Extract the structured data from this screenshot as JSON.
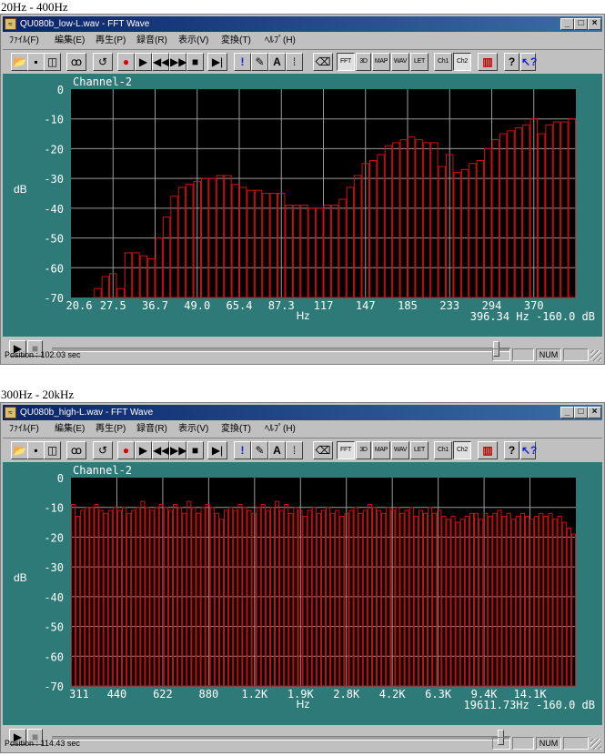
{
  "windows": [
    {
      "caption": "20Hz - 400Hz",
      "title": "QU080b_low-L.wav - FFT Wave",
      "channel_label": "Channel-2",
      "ylabel": "dB",
      "xlabel": "Hz",
      "readout": "396.34  Hz -160.0 dB",
      "status_position": "Position : 102.03 sec",
      "slider_fraction": 0.97
    },
    {
      "caption": "300Hz - 20kHz",
      "title": "QU080b_high-L.wav - FFT Wave",
      "channel_label": "Channel-2",
      "ylabel": "dB",
      "xlabel": "Hz",
      "readout": "19611.73Hz -160.0 dB",
      "status_position": "Position : 114.43 sec",
      "slider_fraction": 0.98
    }
  ],
  "menu": [
    "ﾌｧｲﾙ(F)",
    "編集(E)",
    "再生(P)",
    "録音(R)",
    "表示(V)",
    "変換(T)",
    "ﾍﾙﾌﾟ(H)"
  ],
  "toolbar": {
    "fft": "FFT",
    "3d": "3D",
    "map": "MAP",
    "wav": "WAV",
    "let": "LET",
    "ch1": "Ch1",
    "ch2": "Ch2",
    "text_a": "A"
  },
  "window_buttons": {
    "minimize": "_",
    "maximize": "□",
    "close": "×"
  },
  "status_num": "NUM",
  "colors": {
    "plot_bg": "#2d7a78",
    "plot_area": "#000000",
    "bar_stroke": "#d01010",
    "grid": "#9a9a9a",
    "title_bar": "#0a246a"
  },
  "chart_data": [
    {
      "type": "bar",
      "ylim": [
        -70,
        0
      ],
      "yticks": [
        "0",
        "-10",
        "-20",
        "-30",
        "-40",
        "-50",
        "-60",
        "-70"
      ],
      "xticks": [
        "20.6",
        "27.5",
        "36.7",
        "49.0",
        "65.4",
        "87.3",
        "117",
        "147",
        "185",
        "233",
        "294",
        "370"
      ],
      "values": [
        -71,
        -71,
        -70,
        -67,
        -63,
        -62,
        -67,
        -55,
        -55,
        -56,
        -57,
        -50,
        -43,
        -36,
        -33,
        -32,
        -31,
        -30,
        -30,
        -29,
        -29,
        -32,
        -33,
        -34,
        -34,
        -35,
        -35,
        -35,
        -39,
        -39,
        -39,
        -40,
        -40,
        -39,
        -39,
        -37,
        -33,
        -29,
        -25,
        -24,
        -22,
        -19,
        -18,
        -17,
        -16,
        -17,
        -18,
        -18,
        -26,
        -22,
        -28,
        -27,
        -25,
        -24,
        -20,
        -17,
        -15,
        -14,
        -13,
        -12,
        -10,
        -15,
        -12,
        -11,
        -11,
        -10
      ]
    },
    {
      "type": "bar",
      "ylim": [
        -70,
        0
      ],
      "yticks": [
        "0",
        "-10",
        "-20",
        "-30",
        "-40",
        "-50",
        "-60",
        "-70"
      ],
      "xticks": [
        "311",
        "440",
        "622",
        "880",
        "1.2K",
        "1.9K",
        "2.8K",
        "4.2K",
        "6.3K",
        "9.4K",
        "14.1K"
      ],
      "values": [
        -9,
        -13,
        -11,
        -10,
        -10,
        -9,
        -11,
        -12,
        -11,
        -10,
        -11,
        -10,
        -12,
        -11,
        -10,
        -8,
        -10,
        -11,
        -10,
        -9,
        -10,
        -11,
        -9,
        -10,
        -12,
        -8,
        -10,
        -12,
        -10,
        -9,
        -10,
        -12,
        -14,
        -11,
        -10,
        -11,
        -9,
        -10,
        -11,
        -12,
        -10,
        -9,
        -11,
        -10,
        -8,
        -11,
        -9,
        -12,
        -10,
        -11,
        -13,
        -11,
        -10,
        -12,
        -11,
        -10,
        -12,
        -11,
        -13,
        -12,
        -11,
        -10,
        -12,
        -11,
        -9,
        -10,
        -11,
        -12,
        -10,
        -11,
        -10,
        -12,
        -11,
        -10,
        -13,
        -11,
        -12,
        -10,
        -12,
        -11,
        -13,
        -14,
        -13,
        -15,
        -14,
        -13,
        -12,
        -12,
        -14,
        -12,
        -13,
        -12,
        -11,
        -13,
        -12,
        -14,
        -13,
        -12,
        -13,
        -14,
        -13,
        -12,
        -13,
        -12,
        -14,
        -13,
        -15,
        -17,
        -19
      ]
    }
  ]
}
